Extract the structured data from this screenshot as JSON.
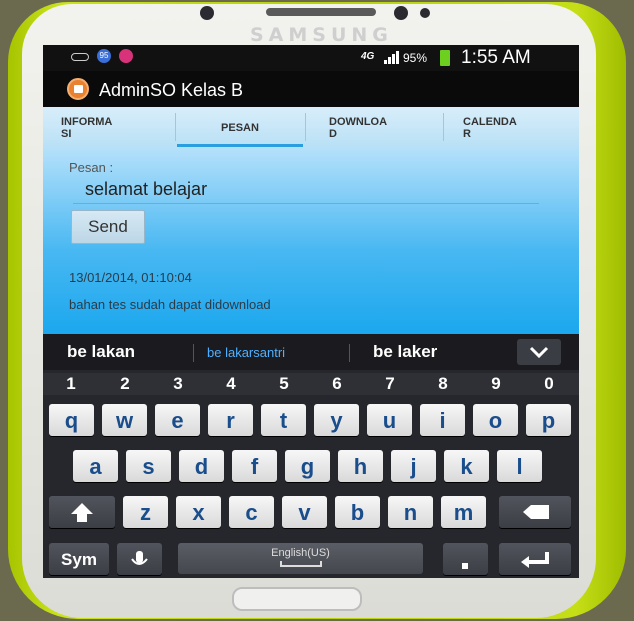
{
  "device": {
    "brand": "SAMSUNG"
  },
  "status_bar": {
    "badge1": "95",
    "network": "4G",
    "battery": "95%",
    "time": "1:55 AM"
  },
  "app": {
    "title": "AdminSO Kelas B"
  },
  "tabs": [
    {
      "label_line1": "INFORMA",
      "label_line2": "SI",
      "active": false
    },
    {
      "label_line1": "PESAN",
      "label_line2": "",
      "active": true
    },
    {
      "label_line1": "DOWNLOA",
      "label_line2": "D",
      "active": false
    },
    {
      "label_line1": "CALENDA",
      "label_line2": "R",
      "active": false
    }
  ],
  "form": {
    "label": "Pesan :",
    "input_value": "selamat belajar",
    "send_label": "Send"
  },
  "messages": [
    {
      "timestamp": "13/01/2014, 01:10:04",
      "text": "bahan tes sudah dapat didownload"
    }
  ],
  "suggestions": {
    "left": "be lakan",
    "middle": "be lakarsantri",
    "right": "be laker"
  },
  "keyboard": {
    "numbers": [
      "1",
      "2",
      "3",
      "4",
      "5",
      "6",
      "7",
      "8",
      "9",
      "0"
    ],
    "row1": [
      "q",
      "w",
      "e",
      "r",
      "t",
      "y",
      "u",
      "i",
      "o",
      "p"
    ],
    "row2": [
      "a",
      "s",
      "d",
      "f",
      "g",
      "h",
      "j",
      "k",
      "l"
    ],
    "row3": [
      "z",
      "x",
      "c",
      "v",
      "b",
      "n",
      "m"
    ],
    "sym_label": "Sym",
    "space_label": "English(US)"
  },
  "colors": {
    "case": "#b8d20e",
    "tab_active": "#2a9fe0",
    "accent_suggestion": "#4fb0ff"
  }
}
